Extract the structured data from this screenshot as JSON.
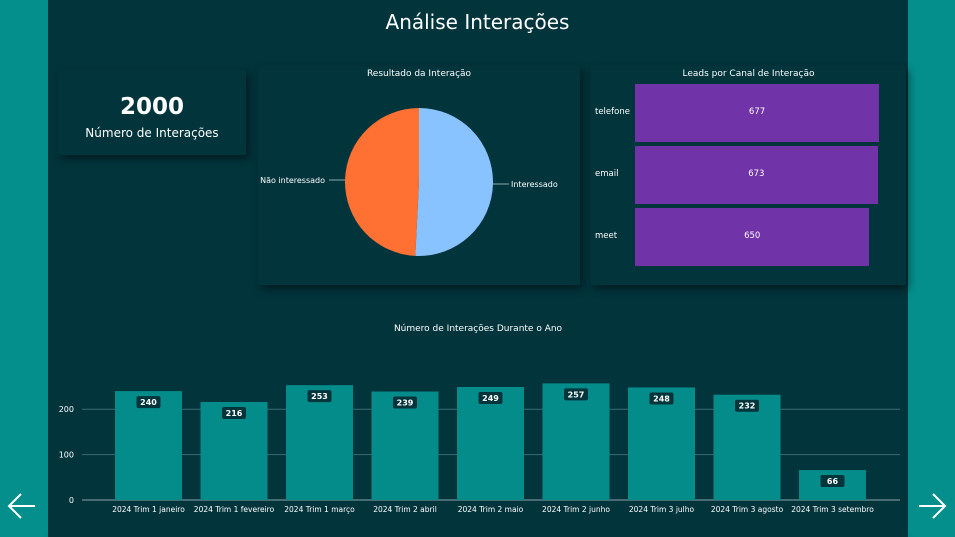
{
  "page": {
    "title": "Análise Interações"
  },
  "colors": {
    "background": "#02343c",
    "teal": "#048c8a",
    "purple": "#7033a8",
    "orange": "#ff7132",
    "lightblue": "#89c3ff"
  },
  "kpi": {
    "value": "2000",
    "label": "Número de Interações"
  },
  "nav": {
    "prev_icon": "arrow-left-icon",
    "next_icon": "arrow-right-icon"
  },
  "chart_data": [
    {
      "type": "pie",
      "title": "Resultado da Interação",
      "labels": [
        "Interessado",
        "Não interessado"
      ],
      "values": [
        1016,
        984
      ],
      "colors": [
        "#89c3ff",
        "#ff7132"
      ]
    },
    {
      "type": "bar",
      "orientation": "horizontal",
      "title": "Leads por Canal de Interação",
      "categories": [
        "telefone",
        "email",
        "meet"
      ],
      "values": [
        677,
        673,
        650
      ],
      "color": "#7033a8",
      "xlim": [
        0,
        710
      ]
    },
    {
      "type": "bar",
      "title": "Número de Interações Durante o Ano",
      "categories": [
        "2024 Trim 1 janeiro",
        "2024 Trim 1 fevereiro",
        "2024 Trim 1 março",
        "2024 Trim 2 abril",
        "2024 Trim 2 maio",
        "2024 Trim 2 junho",
        "2024 Trim 3 julho",
        "2024 Trim 3 agosto",
        "2024 Trim 3 setembro"
      ],
      "values": [
        240,
        216,
        253,
        239,
        249,
        257,
        248,
        232,
        66
      ],
      "yticks": [
        "0",
        "100",
        "200"
      ],
      "ylim": [
        0,
        260
      ],
      "grid": true,
      "color": "#048c8a"
    }
  ]
}
